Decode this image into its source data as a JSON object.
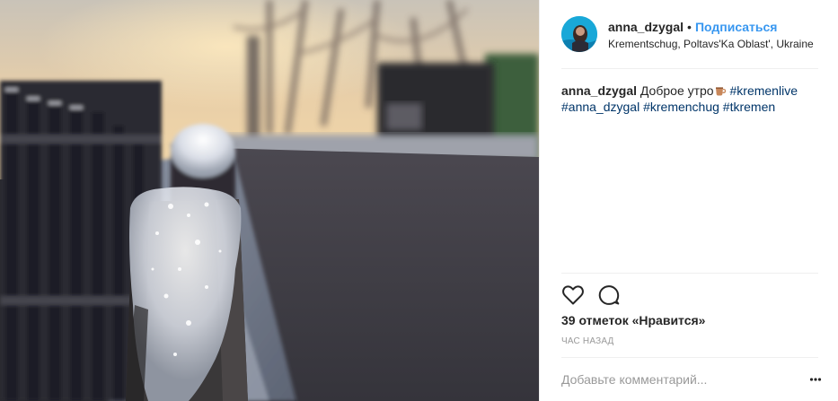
{
  "post": {
    "image_alt": "Snow-covered fence post at sunrise, blurred road in background"
  },
  "header": {
    "username": "anna_dzygal",
    "separator": "•",
    "follow_label": "Подписаться",
    "location": "Krementschug, Poltavs'Ka Oblast', Ukraine",
    "avatar_icon": "profile-photo-icon"
  },
  "caption": {
    "username": "anna_dzygal",
    "text": "Доброе утро",
    "emoji_icon": "coffee-cup-icon",
    "hashtags": [
      "#kremenlive",
      "#anna_dzygal",
      "#kremenchug",
      "#tkremen"
    ]
  },
  "actions": {
    "like_icon": "heart-icon",
    "comment_icon": "speech-bubble-icon",
    "more_icon": "more-options-icon"
  },
  "likes_text": "39 отметок «Нравится»",
  "time_text": "час назад",
  "comment": {
    "placeholder": "Добавьте комментарий...",
    "value": ""
  },
  "colors": {
    "link_blue": "#3897f0",
    "hashtag_blue": "#003569",
    "muted_gray": "#999999",
    "divider": "#efefef"
  }
}
